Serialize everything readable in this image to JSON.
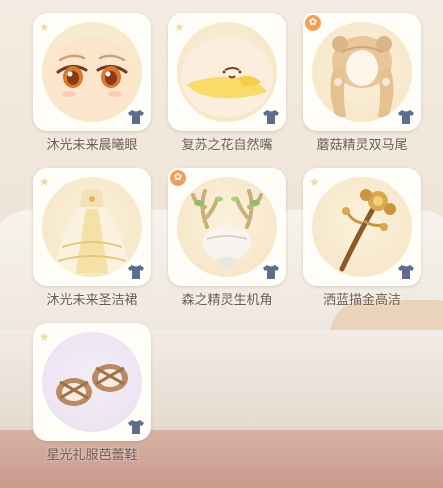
{
  "items": [
    {
      "name": "沐光未来晨曦眼",
      "icon": "eyes-icon",
      "badge": false,
      "bg": "cream"
    },
    {
      "name": "复苏之花自然嘴",
      "icon": "mouth-icon",
      "badge": false,
      "bg": "cream"
    },
    {
      "name": "蘑菇精灵双马尾",
      "icon": "twin-tails-hair-icon",
      "badge": true,
      "bg": "cream"
    },
    {
      "name": "沐光未来圣洁裙",
      "icon": "dress-icon",
      "badge": false,
      "bg": "cream"
    },
    {
      "name": "森之精灵生机角",
      "icon": "antler-horn-icon",
      "badge": true,
      "bg": "cream"
    },
    {
      "name": "洒蓝描金高洁",
      "icon": "golden-staff-icon",
      "badge": false,
      "bg": "cream"
    },
    {
      "name": "星光礼服芭蕾鞋",
      "icon": "ballet-shoes-icon",
      "badge": false,
      "bg": "purple"
    }
  ],
  "badge_symbol": "✿",
  "star_symbol": "★",
  "colors": {
    "label": "#6f5a50",
    "shirt_icon": "#5e6d8c",
    "badge": "#f0a05a"
  }
}
